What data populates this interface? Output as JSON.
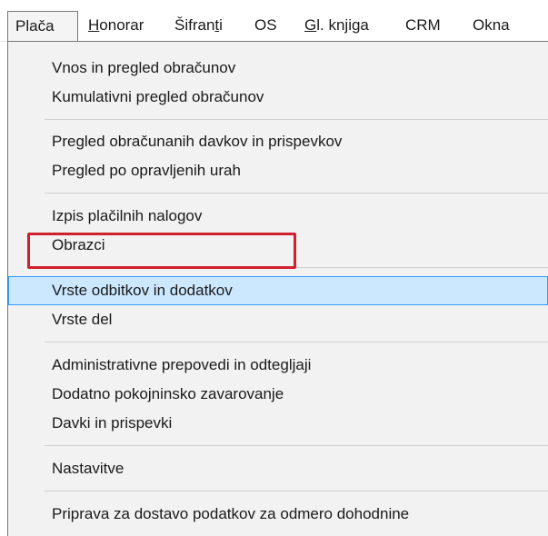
{
  "menubar": {
    "items": [
      {
        "label": "Plača"
      },
      {
        "label": "Honorar",
        "underline": "H"
      },
      {
        "label": "Šifranti",
        "underline": "t"
      },
      {
        "label": "OS"
      },
      {
        "label": "Gl. knjiga",
        "underline": "G"
      },
      {
        "label": "CRM"
      },
      {
        "label": "Okna"
      }
    ]
  },
  "dropdown": {
    "items": [
      {
        "label": "Vnos in pregled obračunov"
      },
      {
        "label": "Kumulativni pregled obračunov"
      },
      {
        "label": "Pregled obračunanih davkov in prispevkov"
      },
      {
        "label": "Pregled po opravljenih urah"
      },
      {
        "label": "Izpis plačilnih nalogov"
      },
      {
        "label": "Obrazci"
      },
      {
        "label": "Vrste odbitkov in dodatkov"
      },
      {
        "label": "Vrste del"
      },
      {
        "label": "Administrativne prepovedi in odtegljaji"
      },
      {
        "label": "Dodatno pokojninsko zavarovanje"
      },
      {
        "label": "Davki in prispevki"
      },
      {
        "label": "Nastavitve"
      },
      {
        "label": "Priprava za dostavo podatkov za odmero dohodnine"
      }
    ]
  },
  "colors": {
    "selection_fill": "#cce8ff",
    "selection_border": "#3399ff",
    "highlight_annotation": "#d0202e",
    "menu_background": "#f2f2f2"
  }
}
